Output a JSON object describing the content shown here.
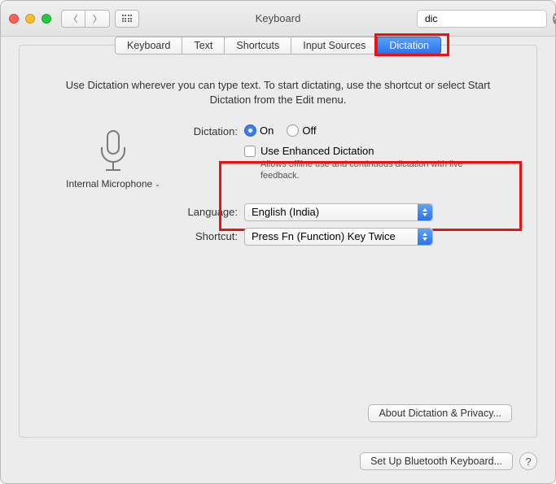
{
  "window": {
    "title": "Keyboard"
  },
  "search": {
    "value": "dic"
  },
  "tabs": {
    "items": [
      "Keyboard",
      "Text",
      "Shortcuts",
      "Input Sources",
      "Dictation"
    ],
    "active": "Dictation"
  },
  "intro": "Use Dictation wherever you can type text. To start dictating, use the shortcut or select Start Dictation from the Edit menu.",
  "mic": {
    "label": "Internal Microphone"
  },
  "dictation": {
    "label": "Dictation:",
    "on_label": "On",
    "off_label": "Off",
    "selected": "On",
    "enhanced_label": "Use Enhanced Dictation",
    "enhanced_checked": false,
    "enhanced_desc": "Allows offline use and continuous dictation with live feedback."
  },
  "language": {
    "label": "Language:",
    "value": "English (India)"
  },
  "shortcut": {
    "label": "Shortcut:",
    "value": "Press Fn (Function) Key Twice"
  },
  "buttons": {
    "privacy": "About Dictation & Privacy...",
    "bluetooth": "Set Up Bluetooth Keyboard...",
    "help": "?"
  }
}
